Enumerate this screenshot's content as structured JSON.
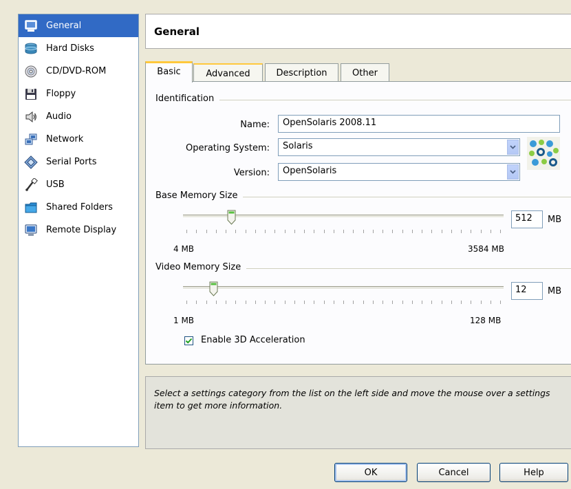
{
  "sidebar": {
    "items": [
      {
        "label": "General",
        "icon": "monitor-icon",
        "selected": true
      },
      {
        "label": "Hard Disks",
        "icon": "hard-disk-icon"
      },
      {
        "label": "CD/DVD-ROM",
        "icon": "cd-dvd-icon"
      },
      {
        "label": "Floppy",
        "icon": "floppy-icon"
      },
      {
        "label": "Audio",
        "icon": "speaker-icon"
      },
      {
        "label": "Network",
        "icon": "network-icon"
      },
      {
        "label": "Serial Ports",
        "icon": "serial-port-icon"
      },
      {
        "label": "USB",
        "icon": "usb-icon"
      },
      {
        "label": "Shared Folders",
        "icon": "folder-icon"
      },
      {
        "label": "Remote Display",
        "icon": "remote-display-icon"
      }
    ]
  },
  "header": {
    "title": "General"
  },
  "tabs": [
    {
      "label": "Basic",
      "active": true
    },
    {
      "label": "Advanced"
    },
    {
      "label": "Description"
    },
    {
      "label": "Other"
    }
  ],
  "basic": {
    "identification_label": "Identification",
    "name_label": "Name:",
    "name_value": "OpenSolaris 2008.11",
    "os_label": "Operating System:",
    "os_value": "Solaris",
    "version_label": "Version:",
    "version_value": "OpenSolaris",
    "os_icon": "opensolaris-logo-icon",
    "base_memory": {
      "label": "Base Memory Size",
      "value": "512",
      "unit": "MB",
      "min_label": "4 MB",
      "max_label": "3584 MB",
      "min": 4,
      "max": 3584,
      "current": 512
    },
    "video_memory": {
      "label": "Video Memory Size",
      "value": "12",
      "unit": "MB",
      "min_label": "1 MB",
      "max_label": "128 MB",
      "min": 1,
      "max": 128,
      "current": 12
    },
    "enable_3d_label": "Enable 3D Acceleration",
    "enable_3d_checked": true
  },
  "info": {
    "text": "Select a settings category from the list on the left side and move the mouse over a settings item to get more information."
  },
  "buttons": {
    "ok": "OK",
    "cancel": "Cancel",
    "help": "Help"
  },
  "colors": {
    "selection": "#316ac5",
    "tab_highlight": "#ffc83c",
    "window_bg": "#ece9d8"
  }
}
